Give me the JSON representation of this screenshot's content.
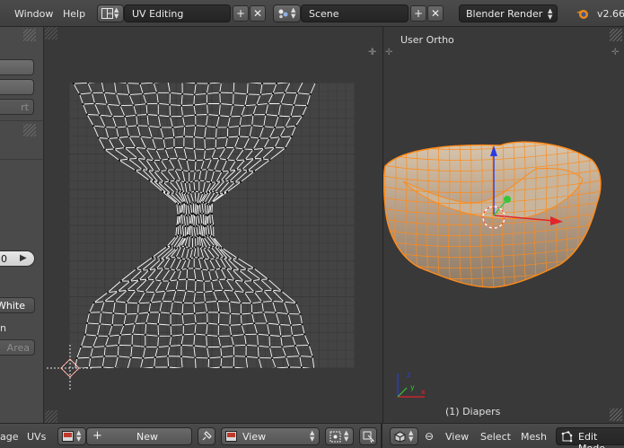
{
  "topbar": {
    "menus": [
      "Window",
      "Help"
    ],
    "screen_layout": "UV Editing",
    "scene": "Scene",
    "render_engine": "Blender Render",
    "version": "v2.66"
  },
  "left_panel": {
    "buttons": [
      "",
      "",
      "rt"
    ],
    "number_value": "0",
    "white_label": "White",
    "n_label": "n",
    "area_label": "Area"
  },
  "viewport": {
    "view_label": "User Ortho",
    "object_label": "(1) Diapers"
  },
  "uv_header": {
    "image_menu": "age",
    "uvs_menu": "UVs",
    "new_label": "New",
    "view_label": "View"
  },
  "view3d_header": {
    "menus": [
      "View",
      "Select",
      "Mesh"
    ],
    "mode_label": "Edit Mode"
  },
  "colors": {
    "accent_orange": "#ff8a18",
    "axis_x": "#e0262b",
    "axis_y": "#35c63a",
    "axis_z": "#2a3de0"
  }
}
